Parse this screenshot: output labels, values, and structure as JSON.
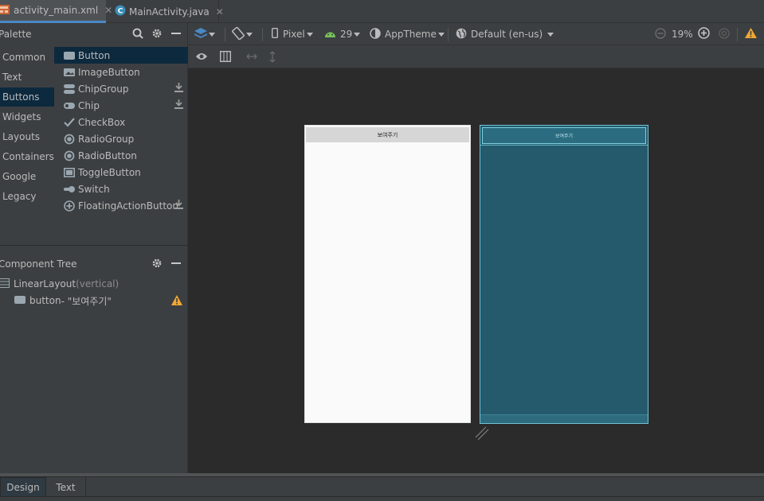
{
  "tabs": [
    {
      "label": "activity_main.xml",
      "icon": "xml-layout-icon",
      "active": true
    },
    {
      "label": "MainActivity.java",
      "icon": "java-class-icon",
      "active": false
    }
  ],
  "palette": {
    "title": "Palette",
    "categories": [
      "Common",
      "Text",
      "Buttons",
      "Widgets",
      "Layouts",
      "Containers",
      "Google",
      "Legacy"
    ],
    "selected_category": "Buttons",
    "items": [
      {
        "label": "Button",
        "icon": "button-icon",
        "download": false
      },
      {
        "label": "ImageButton",
        "icon": "image-button-icon",
        "download": false
      },
      {
        "label": "ChipGroup",
        "icon": "chip-group-icon",
        "download": true
      },
      {
        "label": "Chip",
        "icon": "chip-icon",
        "download": true
      },
      {
        "label": "CheckBox",
        "icon": "checkbox-icon",
        "download": false
      },
      {
        "label": "RadioGroup",
        "icon": "radio-group-icon",
        "download": false
      },
      {
        "label": "RadioButton",
        "icon": "radio-button-icon",
        "download": false
      },
      {
        "label": "ToggleButton",
        "icon": "toggle-button-icon",
        "download": false
      },
      {
        "label": "Switch",
        "icon": "switch-icon",
        "download": false
      },
      {
        "label": "FloatingActionButton",
        "icon": "fab-icon",
        "download": true
      }
    ],
    "selected_item": "Button"
  },
  "component_tree": {
    "title": "Component Tree",
    "root": {
      "name": "LinearLayout",
      "detail": "(vertical)"
    },
    "child": {
      "name": "button",
      "detail": "- \"보여주기\""
    }
  },
  "toolbar": {
    "device": "Pixel",
    "api": "29",
    "theme": "AppTheme",
    "locale": "Default (en-us)",
    "zoom": "19%"
  },
  "preview": {
    "button_text": "보여주기",
    "blueprint_button_text": "보여주기"
  },
  "bottom_tabs": {
    "design": "Design",
    "text": "Text"
  },
  "colors": {
    "accent": "#4a88c7",
    "selection": "#0d293e",
    "warning": "#f0a732",
    "blueprint": "#245a6c"
  }
}
